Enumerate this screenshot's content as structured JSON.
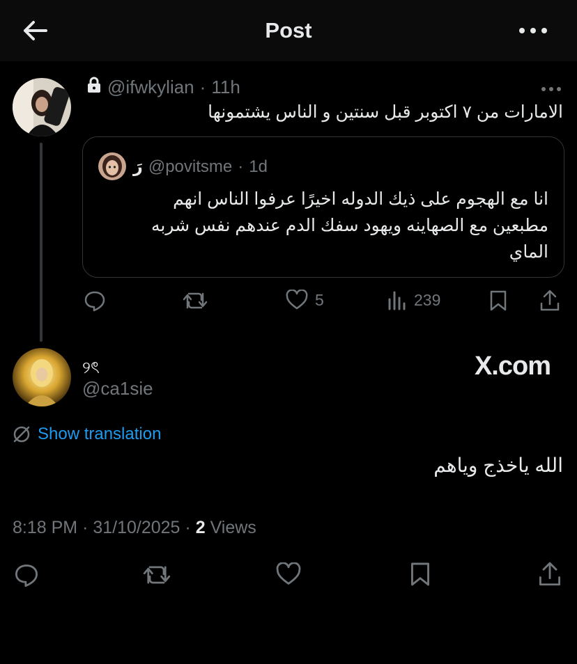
{
  "header": {
    "title": "Post"
  },
  "quoted_reply": {
    "handle": "@ifwkylian",
    "sep": "·",
    "age": "11h",
    "text": "الامارات من ٧ اكتوبر قبل سنتين و الناس يشتمونها",
    "quote": {
      "display_name": "رَ",
      "handle": "@povitsme",
      "age": "1d",
      "line1": "انا مع الهجوم على ذيك الدوله اخيرًا عرفوا الناس انهم",
      "line2": "مطبعين مع الصهاينه ويهود سفك الدم عندهم نفس شربه",
      "line3": "الماي"
    },
    "actions": {
      "likes": "5",
      "views": "239"
    }
  },
  "main_post": {
    "display_name": "୨ৎ",
    "handle": "@ca1sie",
    "watermark": "X.com",
    "translate_label": "Show translation",
    "text": "الله ياخذج وياهم",
    "time": "8:18 PM",
    "sep": "·",
    "date": "31/10/2025",
    "sep2": "·",
    "views_count": "2",
    "views_label": "Views"
  },
  "colors": {
    "accent": "#1d9bf0",
    "muted": "#71767b",
    "text": "#e7e9ea",
    "bg": "#000000"
  },
  "icons": [
    "back-arrow-icon",
    "more-icon",
    "lock-icon",
    "reply-icon",
    "repost-icon",
    "like-icon",
    "views-icon",
    "bookmark-icon",
    "share-icon",
    "translate-icon"
  ]
}
